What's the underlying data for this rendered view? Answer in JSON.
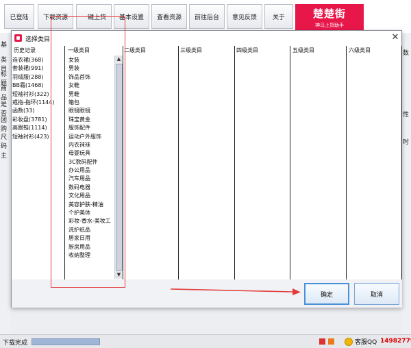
{
  "toolbar": {
    "buttons": [
      "已登陆",
      "下载资源",
      "一键上货",
      "基本设置",
      "查看资源",
      "前往后台",
      "意见反馈",
      "关于"
    ],
    "brand_name": "楚楚街",
    "brand_tag": "神马上货助手"
  },
  "app_left_labels": [
    "基",
    "类目",
    "标题",
    "商品",
    "是否",
    "团购",
    "尺码",
    "主"
  ],
  "app_right_labels": [
    "数",
    "性",
    "时"
  ],
  "dialog": {
    "title": "选择类目",
    "close": "✕",
    "columns": [
      "历史记录",
      "一级类目",
      "二级类目",
      "三级类目",
      "四级类目",
      "五级类目",
      "六级类目"
    ],
    "history": [
      "连衣裙(368)",
      "套装裙(991)",
      "羽绒服(288)",
      "BB霜(1468)",
      "短袖衬衫(322)",
      "戒指-指环(1144)",
      "函数(33)",
      "彩妆盘(3781)",
      "高跟鞋(1114)",
      "短袖衬衫(423)"
    ],
    "level1": [
      "女装",
      "男装",
      "饰品首饰",
      "女鞋",
      "男鞋",
      "箱包",
      "眼镜眼镜",
      "珠宝黄金",
      "服饰配件",
      "运动户外服饰",
      "内衣袜袜",
      "母婴玩具",
      "3C数码配件",
      "办公用品",
      "汽车用品",
      "数码电器",
      "文化用品",
      "美容护肤-精油",
      "个护美体",
      "彩妆-香水-美妆工",
      "洗护纸品",
      "居家日用",
      "厨房用品",
      "收纳整理"
    ],
    "ok_label": "确定",
    "cancel_label": "取消"
  },
  "status": {
    "text": "下载完成",
    "kefu": "客服QQ",
    "qq": "149827790"
  },
  "colors": {
    "brand": "#e8174a",
    "annotation": "#e23b3b"
  }
}
